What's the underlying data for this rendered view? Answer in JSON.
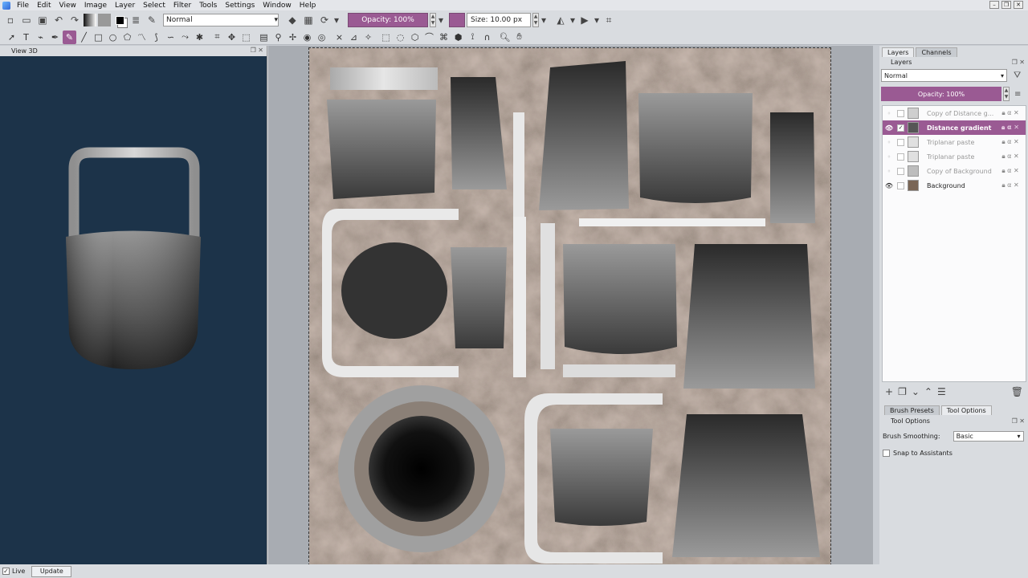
{
  "menu": [
    "File",
    "Edit",
    "View",
    "Image",
    "Layer",
    "Select",
    "Filter",
    "Tools",
    "Settings",
    "Window",
    "Help"
  ],
  "toolbar": {
    "blend_mode": "Normal",
    "opacity": "Opacity: 100%",
    "size": "Size: 10.00 px"
  },
  "view3d": {
    "title": "View 3D",
    "live_label": "Live",
    "update_label": "Update"
  },
  "layers_panel": {
    "tabs": [
      "Layers",
      "Channels"
    ],
    "title": "Layers",
    "blend_mode": "Normal",
    "opacity": "Opacity: 100%",
    "layers": [
      {
        "name": "Copy of Distance g...",
        "visible": false,
        "active": false
      },
      {
        "name": "Distance gradient",
        "visible": true,
        "active": true
      },
      {
        "name": "Triplanar paste",
        "visible": false,
        "active": false
      },
      {
        "name": "Triplanar paste",
        "visible": false,
        "active": false
      },
      {
        "name": "Copy of Background",
        "visible": false,
        "active": false
      },
      {
        "name": "Background",
        "visible": true,
        "active": false
      }
    ]
  },
  "tool_panel": {
    "tabs": [
      "Brush Presets",
      "Tool Options"
    ],
    "title": "Tool Options",
    "smoothing_label": "Brush Smoothing:",
    "smoothing_value": "Basic",
    "snap_label": "Snap to Assistants"
  },
  "colors": {
    "accent": "#9a5a93",
    "view3d_bg": "#1c3349",
    "texture": "#7a6656"
  }
}
